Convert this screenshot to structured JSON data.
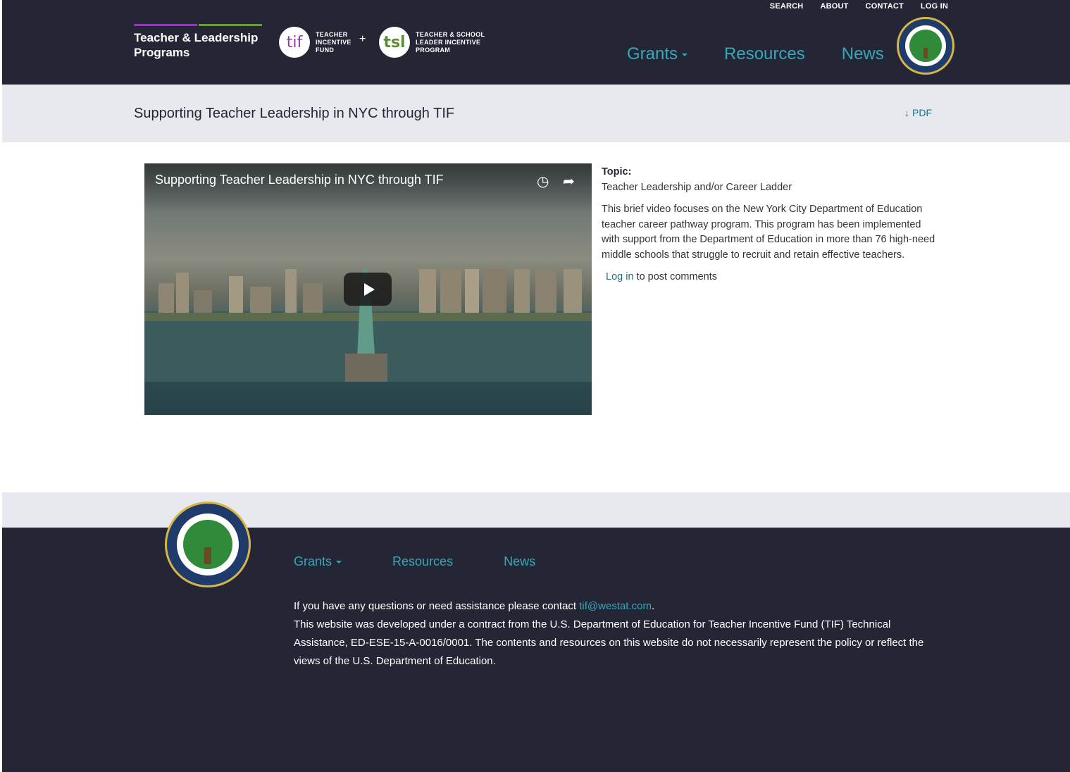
{
  "top_links": [
    "SEARCH",
    "ABOUT",
    "CONTACT",
    "LOG IN"
  ],
  "brand": {
    "line1": "Teacher & Leadership",
    "line2": "Programs"
  },
  "tif": {
    "abbr": "tif",
    "line1": "TEACHER",
    "line2": "INCENTIVE",
    "line3": "FUND"
  },
  "plus": "+",
  "tsl": {
    "abbr": "tsl",
    "line1": "TEACHER & SCHOOL",
    "line2": "LEADER INCENTIVE",
    "line3": "PROGRAM"
  },
  "main_nav": {
    "grants": "Grants",
    "resources": "Resources",
    "news": "News"
  },
  "page_title": "Supporting Teacher Leadership in NYC through TIF",
  "pdf_label": "PDF",
  "video": {
    "title": "Supporting Teacher Leadership in NYC through TIF"
  },
  "topic": {
    "label": "Topic:",
    "value": "Teacher Leadership and/or Career Ladder"
  },
  "description": "This brief video focuses on the New York City Department of Education teacher career pathway program.  This program has been implemented with support from the Department of Education in more than 76 high-need middle schools that struggle to recruit and retain effective teachers.",
  "comments": {
    "login_link": "Log in",
    "suffix": " to post comments"
  },
  "footer_nav": {
    "grants": "Grants",
    "resources": "Resources",
    "news": "News"
  },
  "footer": {
    "contact_prefix": "If you have any questions or need assistance please contact ",
    "email": "tif@westat.com",
    "contact_suffix": ".",
    "disclaimer": "This website was developed under a contract from the U.S. Department of Education for Teacher Incentive Fund (TIF) Technical Assistance, ED-ESE-15-A-0016/0001. The contents and resources on this website do not necessarily represent the policy or reflect the views of the U.S. Department of Education."
  },
  "colors": {
    "header_bg": "#242636",
    "accent": "#36a8b7",
    "band_bg": "#e8e9ee",
    "link": "#1f6f7a"
  }
}
